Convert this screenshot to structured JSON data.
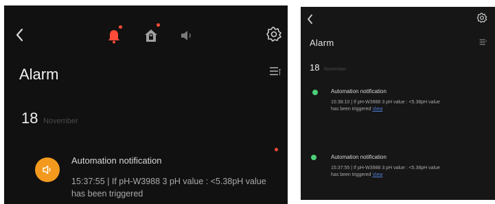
{
  "left_panel": {
    "title": "Alarm",
    "date": {
      "day": "18",
      "month": "November"
    },
    "icons": [
      "back-icon",
      "bell-icon",
      "house-lock-icon",
      "speaker-icon",
      "gear-icon",
      "filter-list-icon"
    ],
    "notification": {
      "title": "Automation notification",
      "time": "15:37:55",
      "separator": "|",
      "message": "If pH-W3988 3 pH value : <5.38pH value has been triggered",
      "icon": "speaker-icon"
    }
  },
  "right_panel": {
    "title": "Alarm",
    "date": {
      "day": "18",
      "month": "November"
    },
    "icons": [
      "back-icon",
      "gear-icon",
      "filter-list-icon"
    ],
    "notifications": [
      {
        "title": "Automation notification",
        "time": "15:38:10",
        "separator": "|",
        "message": "If pH-W3988 3 pH value : <5.38pH value has been triggered",
        "link": "View"
      },
      {
        "title": "Automation notification",
        "time": "15:37:55",
        "separator": "|",
        "message": "If pH-W3988 3 pH value : <5.38pH value has been triggered",
        "link": "View"
      }
    ]
  },
  "colors": {
    "background": "#111111",
    "accent_red": "#ff4b3a",
    "accent_orange": "#f39a1e",
    "status_green": "#4cd07a",
    "link_blue": "#4f7fd9",
    "icon_gray": "#9a9a9a"
  }
}
